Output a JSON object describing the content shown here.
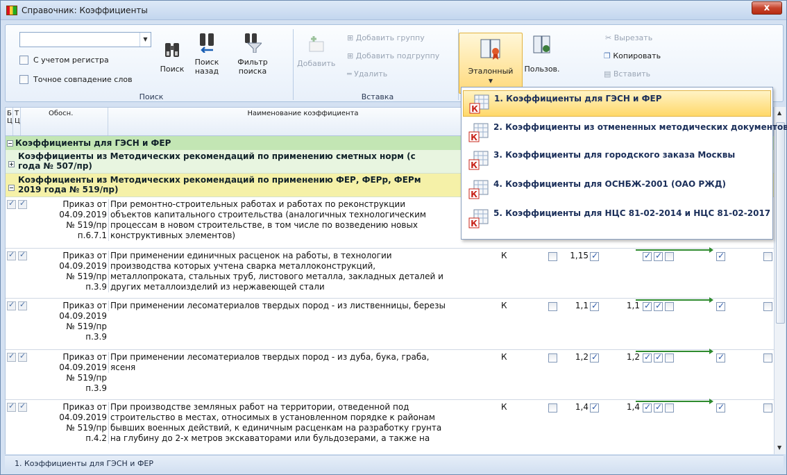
{
  "window": {
    "title": "Справочник: Коэффициенты",
    "close_label": "x"
  },
  "ribbon": {
    "search": {
      "combo_value": "",
      "case_label": "С учетом регистра",
      "exact_label": "Точное совпадение слов",
      "find_label": "Поиск",
      "find_back_label": "Поиск назад",
      "filter_label": "Фильтр поиска",
      "group_label": "Поиск"
    },
    "insert": {
      "add_label": "Добавить",
      "add_group_label": "Добавить группу",
      "add_subgroup_label": "Добавить подгруппу",
      "delete_label": "Удалить",
      "group_label": "Вставка"
    },
    "reference_label": "Эталонный",
    "user_label": "Пользов.",
    "clipboard": {
      "cut_label": "Вырезать",
      "copy_label": "Копировать",
      "paste_label": "Вставить"
    }
  },
  "table": {
    "headers": {
      "b": "Б",
      "c1": "Ц",
      "t": "Т",
      "c2": "Ц",
      "basis": "Обосн.",
      "name": "Наименование коэффициента"
    },
    "group1": "Коэффициенты для ГЭСН и ФЕР",
    "group2": "Коэффициенты из Методических рекомендаций по применению сметных норм (с... года № 507/пр)",
    "group2_line1": "Коэффициенты из Методических рекомендаций по применению сметных норм (с",
    "group2_line2": "года № 507/пр)",
    "group3_line1": "Коэффициенты из Методических рекомендаций по применению ФЕР, ФЕРр, ФЕРм",
    "group3_line2": "2019 года № 519/пр)",
    "rows": [
      {
        "basis": [
          "Приказ от",
          "04.09.2019",
          "№ 519/пр",
          "п.6.7.1"
        ],
        "name": [
          "При ремонтно-строительных работах и работах по реконструкции",
          "объектов капитального строительства (аналогичных технологическим",
          "процессам в новом строительстве, в том числе по возведению новых",
          "конструктивных элементов)"
        ],
        "k": "",
        "v1": "",
        "v2": ""
      },
      {
        "basis": [
          "Приказ от",
          "04.09.2019",
          "№ 519/пр",
          "п.3.9"
        ],
        "name": [
          "При применении единичных расценок на работы, в технологии",
          "производства которых учтена сварка металлоконструкций,",
          "металлопроката, стальных труб, листового металла, закладных деталей и",
          "других металлоизделий из нержавеющей стали"
        ],
        "k": "К",
        "v1": "1,15",
        "v2": ""
      },
      {
        "basis": [
          "Приказ от",
          "04.09.2019",
          "№ 519/пр",
          "п.3.9"
        ],
        "name": [
          "При применении лесоматериалов твердых пород - из лиственницы, березы"
        ],
        "k": "К",
        "v1": "1,1",
        "v2": "1,1"
      },
      {
        "basis": [
          "Приказ от",
          "04.09.2019",
          "№ 519/пр",
          "п.3.9"
        ],
        "name": [
          "При применении лесоматериалов твердых пород - из дуба, бука, граба,",
          "ясеня"
        ],
        "k": "К",
        "v1": "1,2",
        "v2": "1,2"
      },
      {
        "basis": [
          "Приказ от",
          "04.09.2019",
          "№ 519/пр",
          "п.4.2"
        ],
        "name": [
          "При производстве земляных работ на территории, отведенной под",
          "строительство в местах, относимых в установленном порядке к районам",
          "бывших военных действий, к единичным расценкам на разработку грунта",
          "на глубину до 2-х метров экскаваторами или бульдозерами, а также на"
        ],
        "k": "К",
        "v1": "1,4",
        "v2": "1,4"
      }
    ]
  },
  "menu": {
    "items": [
      "1. Коэффициенты для ГЭСН и ФЕР",
      "2. Коэффициенты из отмененных методических документов",
      "3. Коэффициенты для городского заказа Москвы",
      "4. Коэффициенты для ОСНБЖ-2001 (ОАО РЖД)",
      "5. Коэффициенты для НЦС 81-02-2014 и НЦС 81-02-2017"
    ],
    "icon_letter": "К"
  },
  "status": "1. Коэффициенты для ГЭСН и ФЕР"
}
